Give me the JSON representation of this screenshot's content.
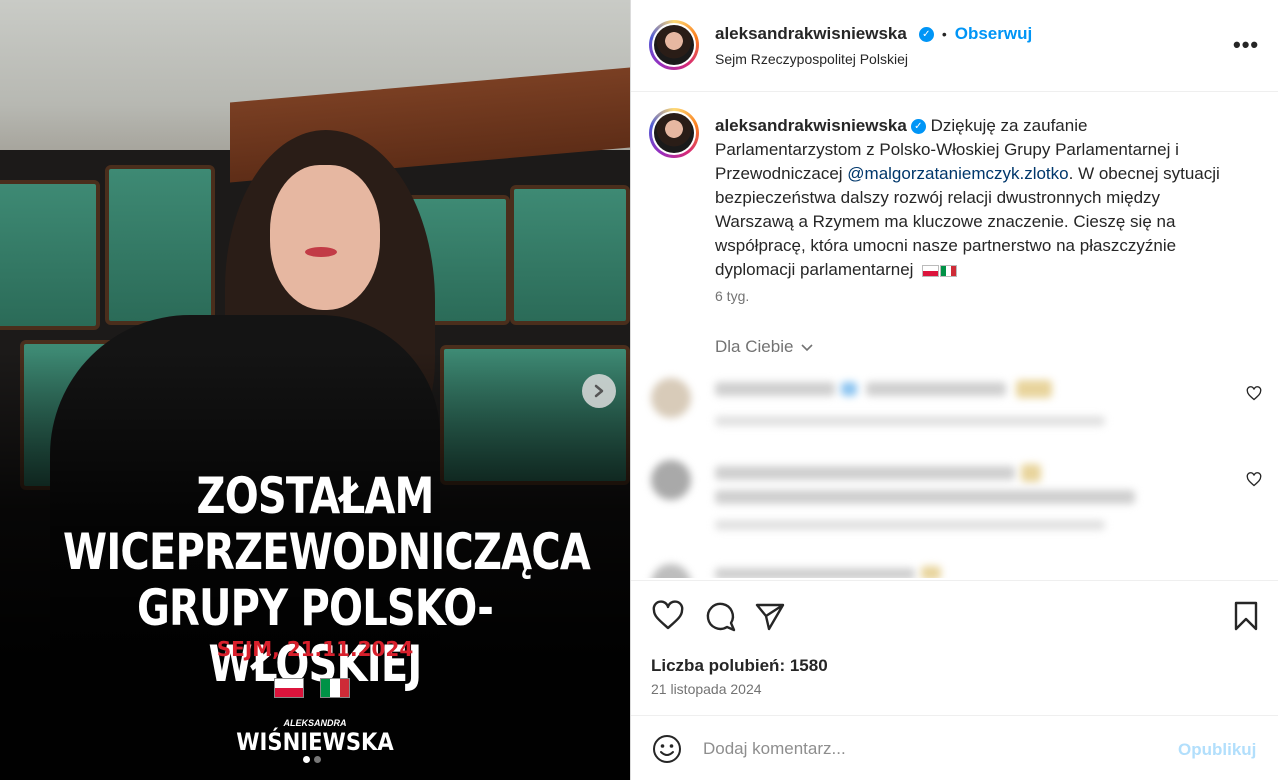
{
  "media": {
    "headline_line1": "ZOSTAŁAM",
    "headline_line2": "WICEPRZEWODNICZĄCA",
    "headline_line3": "GRUPY POLSKO-WŁOSKIEJ",
    "date": "SEJM, 21.11.2024",
    "signature_top": "ALEKSANDRA",
    "signature": "WIŚNIEWSKA",
    "next_icon": "chevron-right-icon",
    "carousel": {
      "total": 2,
      "current": 1
    }
  },
  "header": {
    "username": "aleksandrakwisniewska",
    "separator": "•",
    "follow_label": "Obserwuj",
    "location": "Sejm Rzeczypospolitej Polskiej",
    "more_label": "•••"
  },
  "caption": {
    "username": "aleksandrakwisniewska",
    "text_before_mention": "Dziękuję za zaufanie Parlamentarzystom z Polsko-Włoskiej Grupy Parlamentarnej i Przewodniczacej ",
    "mention": "@malgorzataniemczyk.zlotko",
    "text_after_mention": ". W obecnej sytuacji bezpieczeństwa dalszy rozwój relacji dwustronnych między Warszawą a Rzymem ma kluczowe znaczenie. Cieszę się na współpracę, która umocni nasze partnerstwo na płaszczyźnie dyplomacji parlamentarnej",
    "time": "6 tyg."
  },
  "comments": {
    "filter_label": "Dla Ciebie",
    "filter_icon": "chevron-down-icon"
  },
  "actions": {
    "likes": "Liczba polubień: 1580",
    "date": "21 listopada 2024"
  },
  "comment_box": {
    "placeholder": "Dodaj komentarz...",
    "publish_label": "Opublikuj"
  },
  "colors": {
    "accent": "#0095f6",
    "date_red": "#d8202c",
    "pl_white": "#ffffff",
    "pl_red": "#dc143c",
    "it_green": "#009246",
    "it_red": "#ce2b37",
    "publish_disabled": "#b2dffc"
  }
}
